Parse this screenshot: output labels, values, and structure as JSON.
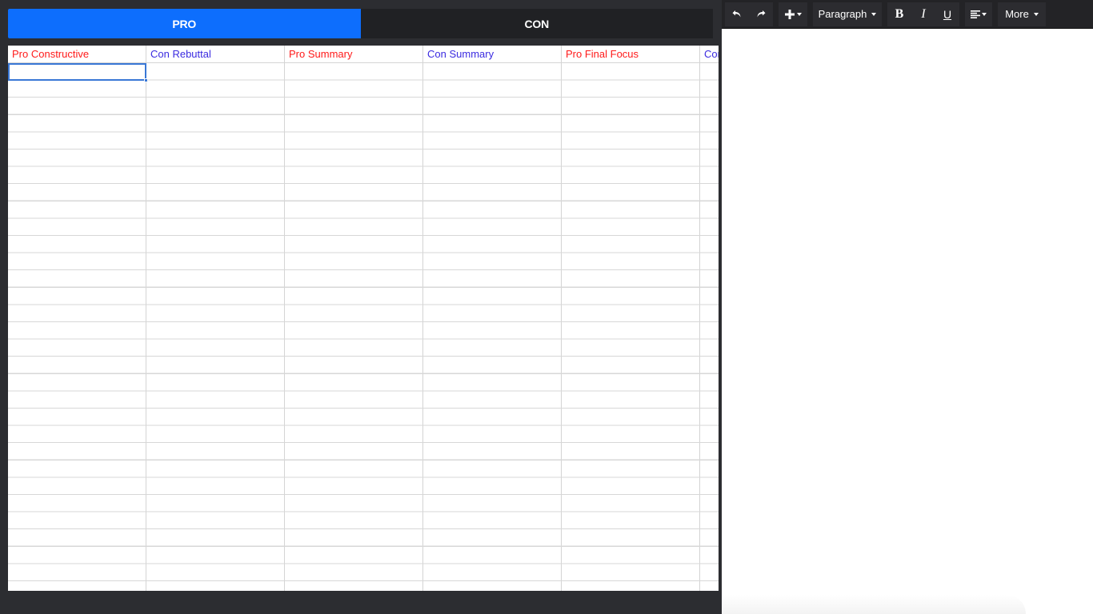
{
  "tabs": [
    {
      "label": "PRO",
      "active": true
    },
    {
      "label": "CON",
      "active": false
    }
  ],
  "grid": {
    "columns": [
      {
        "label": "Pro Constructive",
        "color": "#ff1a1a"
      },
      {
        "label": "Con Rebuttal",
        "color": "#3b2be0"
      },
      {
        "label": "Pro Summary",
        "color": "#ff1a1a"
      },
      {
        "label": "Con Summary",
        "color": "#3b2be0"
      },
      {
        "label": "Pro Final Focus",
        "color": "#ff1a1a"
      },
      {
        "label": "Con Final Focus",
        "color": "#3b2be0"
      }
    ]
  },
  "toolbar": {
    "undo_icon": "undo-icon",
    "redo_icon": "redo-icon",
    "insert_icon": "plus-icon",
    "paragraph_label": "Paragraph",
    "bold_label": "B",
    "italic_label": "I",
    "underline_label": "U",
    "align_icon": "align-left-icon",
    "more_label": "More"
  },
  "colors": {
    "accent": "#0d6efd",
    "pro": "#ff1a1a",
    "con": "#3b2be0",
    "toolbar_bg": "#232326",
    "page_bg": "#2c2d31"
  }
}
